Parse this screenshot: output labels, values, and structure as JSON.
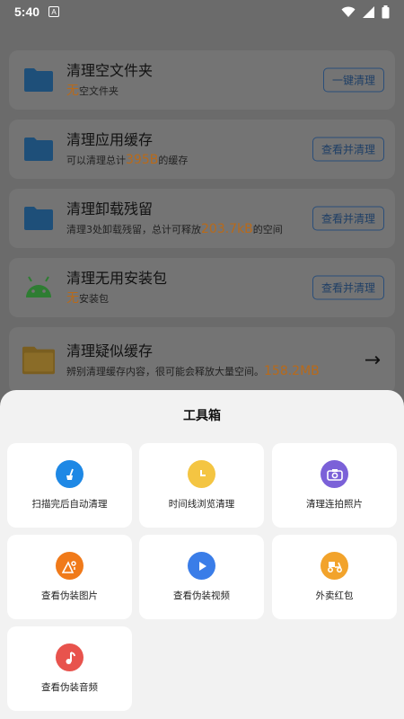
{
  "status_bar": {
    "time": "5:40",
    "notif_icon": "A"
  },
  "items": [
    {
      "title": "清理空文件夹",
      "sub_pre": "",
      "highlight": "无",
      "sub_post": "空文件夹",
      "button": "一键清理",
      "icon": "folder-icon"
    },
    {
      "title": "清理应用缓存",
      "sub_pre": "可以清理总计",
      "highlight": "395B",
      "sub_post": "的缓存",
      "button": "查看并清理",
      "icon": "folder-icon"
    },
    {
      "title": "清理卸载残留",
      "sub_pre": "清理3处卸载残留，总计可释放",
      "highlight": "203.7kB",
      "sub_post": "的空间",
      "button": "查看并清理",
      "icon": "folder-icon"
    },
    {
      "title": "清理无用安装包",
      "sub_pre": "",
      "highlight": "无",
      "sub_post": "安装包",
      "button": "查看并清理",
      "icon": "android-icon"
    },
    {
      "title": "清理疑似缓存",
      "sub_pre": "辨别清理缓存内容，很可能会释放大量空间。",
      "highlight": "158.2MB",
      "sub_post": "",
      "button": "",
      "icon": "folder-open-icon"
    }
  ],
  "toolbox": {
    "title": "工具箱",
    "tools": [
      {
        "label": "扫描完后自动清理",
        "icon": "broom-icon",
        "color": "#1e88e5"
      },
      {
        "label": "时间线浏览清理",
        "icon": "clock-icon",
        "color": "#f4c542"
      },
      {
        "label": "清理连拍照片",
        "icon": "camera-icon",
        "color": "#7b61d8"
      },
      {
        "label": "查看伪装图片",
        "icon": "image-icon",
        "color": "#f07a1a"
      },
      {
        "label": "查看伪装视频",
        "icon": "play-icon",
        "color": "#3a7de8"
      },
      {
        "label": "外卖红包",
        "icon": "scooter-icon",
        "color": "#f2a32b"
      },
      {
        "label": "查看伪装音频",
        "icon": "music-icon",
        "color": "#e8534d"
      }
    ]
  }
}
